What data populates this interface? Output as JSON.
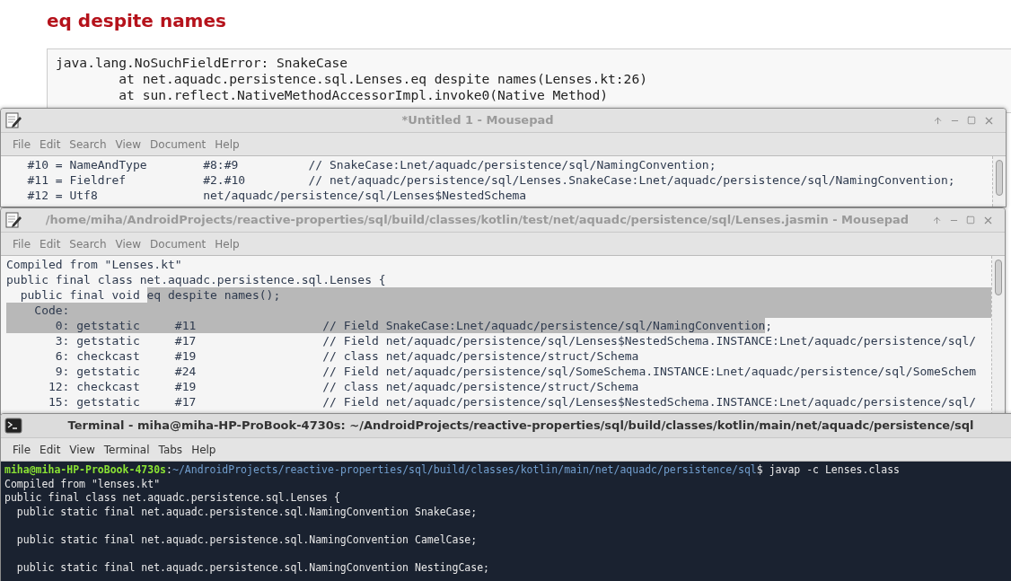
{
  "page": {
    "heading": "eq despite names",
    "code_lines": [
      "java.lang.NoSuchFieldError: SnakeCase",
      "        at net.aquadc.persistence.sql.Lenses.eq despite names(Lenses.kt:26)",
      "        at sun.reflect.NativeMethodAccessorImpl.invoke0(Native Method)"
    ]
  },
  "windows": [
    {
      "kind": "editor",
      "title": "*Untitled 1 - Mousepad",
      "active": false,
      "menu": [
        "File",
        "Edit",
        "Search",
        "View",
        "Document",
        "Help"
      ],
      "lines": [
        {
          "segments": [
            {
              "text": "   #10 = NameAndType        #8:#9          // SnakeCase:Lnet/aquadc/persistence/sql/NamingConvention;",
              "selected": false
            }
          ]
        },
        {
          "segments": [
            {
              "text": "   #11 = Fieldref           #2.#10         // net/aquadc/persistence/sql/Lenses.SnakeCase:Lnet/aquadc/persistence/sql/NamingConvention;",
              "selected": false
            }
          ]
        },
        {
          "segments": [
            {
              "text": "   #12 = Utf8               net/aquadc/persistence/sql/Lenses$NestedSchema",
              "selected": false
            }
          ]
        }
      ]
    },
    {
      "kind": "editor",
      "title": "/home/miha/AndroidProjects/reactive-properties/sql/build/classes/kotlin/test/net/aquadc/persistence/sql/Lenses.jasmin - Mousepad",
      "active": false,
      "menu": [
        "File",
        "Edit",
        "Search",
        "View",
        "Document",
        "Help"
      ],
      "lines": [
        {
          "segments": [
            {
              "text": "Compiled from \"Lenses.kt\"",
              "selected": false
            }
          ]
        },
        {
          "segments": [
            {
              "text": "public final class net.aquadc.persistence.sql.Lenses {",
              "selected": false
            }
          ]
        },
        {
          "segments": [
            {
              "text": "  public final void ",
              "selected": false
            },
            {
              "text": "eq despite names();",
              "selected": true
            }
          ]
        },
        {
          "segments": [
            {
              "text": "    Code:",
              "selected": true
            }
          ]
        },
        {
          "segments": [
            {
              "text": "       0: getstatic     #11                  // Field SnakeCase:Lnet/aquadc/persistence/sql/NamingConvention",
              "selected": true
            },
            {
              "text": ";",
              "selected": false
            }
          ]
        },
        {
          "segments": [
            {
              "text": "       3: getstatic     #17                  // Field net/aquadc/persistence/sql/Lenses$NestedSchema.INSTANCE:Lnet/aquadc/persistence/sql/",
              "selected": false
            }
          ]
        },
        {
          "segments": [
            {
              "text": "       6: checkcast     #19                  // class net/aquadc/persistence/struct/Schema",
              "selected": false
            }
          ]
        },
        {
          "segments": [
            {
              "text": "       9: getstatic     #24                  // Field net/aquadc/persistence/sql/SomeSchema.INSTANCE:Lnet/aquadc/persistence/sql/SomeSchem",
              "selected": false
            }
          ]
        },
        {
          "segments": [
            {
              "text": "      12: checkcast     #19                  // class net/aquadc/persistence/struct/Schema",
              "selected": false
            }
          ]
        },
        {
          "segments": [
            {
              "text": "      15: getstatic     #17                  // Field net/aquadc/persistence/sql/Lenses$NestedSchema.INSTANCE:Lnet/aquadc/persistence/sql/",
              "selected": false
            }
          ]
        }
      ]
    },
    {
      "kind": "terminal",
      "title": "Terminal - miha@miha-HP-ProBook-4730s: ~/AndroidProjects/reactive-properties/sql/build/classes/kotlin/main/net/aquadc/persistence/sql",
      "active": true,
      "menu": [
        "File",
        "Edit",
        "View",
        "Terminal",
        "Tabs",
        "Help"
      ],
      "lines": [
        {
          "blank_before": false,
          "segments": [
            {
              "kind": "user",
              "text": "miha@miha-HP-ProBook-4730s"
            },
            {
              "kind": "plain",
              "text": ":"
            },
            {
              "kind": "path",
              "text": "~/AndroidProjects/reactive-properties/sql/build/classes/kotlin/main/net/aquadc/persistence/sql"
            },
            {
              "kind": "plain",
              "text": "$ javap -c Lenses.class"
            }
          ]
        },
        {
          "blank_before": false,
          "segments": [
            {
              "kind": "plain",
              "text": "Compiled from \"lenses.kt\""
            }
          ]
        },
        {
          "blank_before": false,
          "segments": [
            {
              "kind": "plain",
              "text": "public final class net.aquadc.persistence.sql.Lenses {"
            }
          ]
        },
        {
          "blank_before": false,
          "segments": [
            {
              "kind": "plain",
              "text": "  public static final net.aquadc.persistence.sql.NamingConvention SnakeCase;"
            }
          ]
        },
        {
          "blank_before": true,
          "segments": [
            {
              "kind": "plain",
              "text": "  public static final net.aquadc.persistence.sql.NamingConvention CamelCase;"
            }
          ]
        },
        {
          "blank_before": true,
          "segments": [
            {
              "kind": "plain",
              "text": "  public static final net.aquadc.persistence.sql.NamingConvention NestingCase;"
            }
          ]
        }
      ]
    }
  ]
}
